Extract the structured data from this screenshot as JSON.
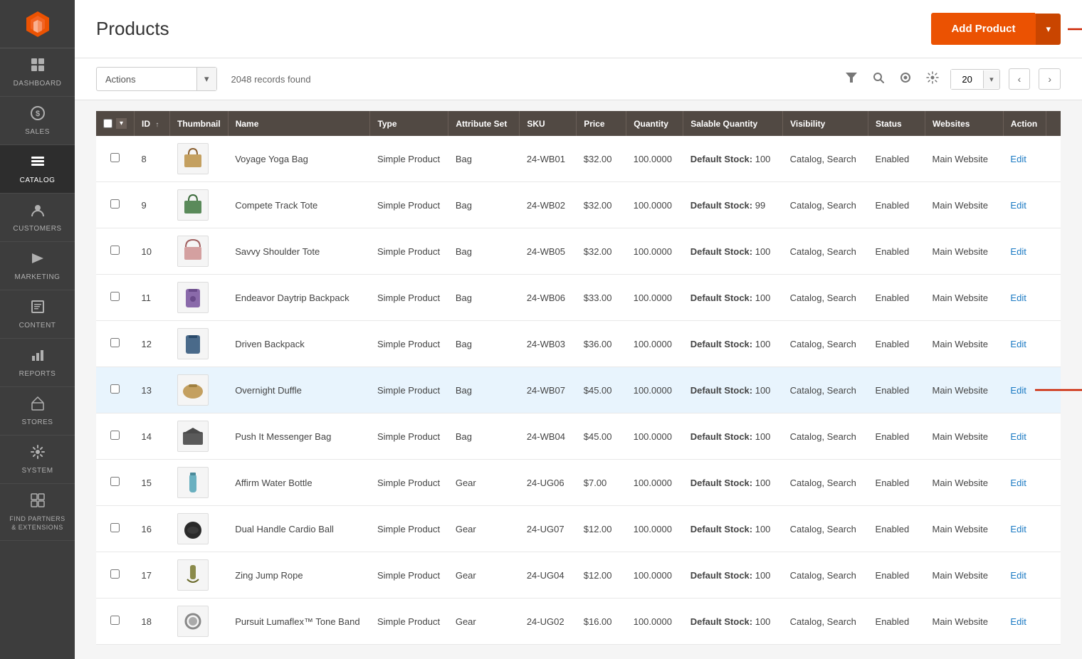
{
  "sidebar": {
    "logo_color": "#eb5202",
    "items": [
      {
        "id": "dashboard",
        "label": "DASHBOARD",
        "icon": "⊞",
        "active": false
      },
      {
        "id": "sales",
        "label": "SALES",
        "icon": "$",
        "active": false
      },
      {
        "id": "catalog",
        "label": "CATALOG",
        "icon": "☷",
        "active": true
      },
      {
        "id": "customers",
        "label": "CUSTOMERS",
        "icon": "👤",
        "active": false
      },
      {
        "id": "marketing",
        "label": "MARKETING",
        "icon": "📢",
        "active": false
      },
      {
        "id": "content",
        "label": "CONTENT",
        "icon": "▦",
        "active": false
      },
      {
        "id": "reports",
        "label": "REPORTS",
        "icon": "📊",
        "active": false
      },
      {
        "id": "stores",
        "label": "STORES",
        "icon": "🏪",
        "active": false
      },
      {
        "id": "system",
        "label": "SYSTEM",
        "icon": "⚙",
        "active": false
      },
      {
        "id": "find-partners",
        "label": "FIND PARTNERS & EXTENSIONS",
        "icon": "🧩",
        "active": false
      }
    ]
  },
  "header": {
    "title": "Products",
    "add_button_label": "Add Product",
    "add_button_arrow": "▾"
  },
  "toolbar": {
    "actions_label": "Actions",
    "records_count": "2048 records found",
    "per_page_value": "20",
    "per_page_placeholder": "20",
    "prev_label": "‹",
    "next_label": "›"
  },
  "table": {
    "columns": [
      {
        "id": "cb",
        "label": ""
      },
      {
        "id": "id",
        "label": "ID",
        "sortable": true
      },
      {
        "id": "thumbnail",
        "label": "Thumbnail"
      },
      {
        "id": "name",
        "label": "Name"
      },
      {
        "id": "type",
        "label": "Type"
      },
      {
        "id": "attribute_set",
        "label": "Attribute Set"
      },
      {
        "id": "sku",
        "label": "SKU"
      },
      {
        "id": "price",
        "label": "Price"
      },
      {
        "id": "quantity",
        "label": "Quantity"
      },
      {
        "id": "salable_quantity",
        "label": "Salable Quantity"
      },
      {
        "id": "visibility",
        "label": "Visibility"
      },
      {
        "id": "status",
        "label": "Status"
      },
      {
        "id": "websites",
        "label": "Websites"
      },
      {
        "id": "action",
        "label": "Action"
      },
      {
        "id": "more",
        "label": ""
      }
    ],
    "rows": [
      {
        "id": 8,
        "name": "Voyage Yoga Bag",
        "type": "Simple Product",
        "attribute_set": "Bag",
        "sku": "24-WB01",
        "price": "$32.00",
        "quantity": "100.0000",
        "salable_quantity": "Default Stock: 100",
        "visibility": "Catalog, Search",
        "status": "Enabled",
        "websites": "Main Website",
        "highlighted": false
      },
      {
        "id": 9,
        "name": "Compete Track Tote",
        "type": "Simple Product",
        "attribute_set": "Bag",
        "sku": "24-WB02",
        "price": "$32.00",
        "quantity": "100.0000",
        "salable_quantity": "Default Stock: 99",
        "visibility": "Catalog, Search",
        "status": "Enabled",
        "websites": "Main Website",
        "highlighted": false
      },
      {
        "id": 10,
        "name": "Savvy Shoulder Tote",
        "type": "Simple Product",
        "attribute_set": "Bag",
        "sku": "24-WB05",
        "price": "$32.00",
        "quantity": "100.0000",
        "salable_quantity": "Default Stock: 100",
        "visibility": "Catalog, Search",
        "status": "Enabled",
        "websites": "Main Website",
        "highlighted": false
      },
      {
        "id": 11,
        "name": "Endeavor Daytrip Backpack",
        "type": "Simple Product",
        "attribute_set": "Bag",
        "sku": "24-WB06",
        "price": "$33.00",
        "quantity": "100.0000",
        "salable_quantity": "Default Stock: 100",
        "visibility": "Catalog, Search",
        "status": "Enabled",
        "websites": "Main Website",
        "highlighted": false
      },
      {
        "id": 12,
        "name": "Driven Backpack",
        "type": "Simple Product",
        "attribute_set": "Bag",
        "sku": "24-WB03",
        "price": "$36.00",
        "quantity": "100.0000",
        "salable_quantity": "Default Stock: 100",
        "visibility": "Catalog, Search",
        "status": "Enabled",
        "websites": "Main Website",
        "highlighted": false
      },
      {
        "id": 13,
        "name": "Overnight Duffle",
        "type": "Simple Product",
        "attribute_set": "Bag",
        "sku": "24-WB07",
        "price": "$45.00",
        "quantity": "100.0000",
        "salable_quantity": "Default Stock: 100",
        "visibility": "Catalog, Search",
        "status": "Enabled",
        "websites": "Main Website",
        "highlighted": true
      },
      {
        "id": 14,
        "name": "Push It Messenger Bag",
        "type": "Simple Product",
        "attribute_set": "Bag",
        "sku": "24-WB04",
        "price": "$45.00",
        "quantity": "100.0000",
        "salable_quantity": "Default Stock: 100",
        "visibility": "Catalog, Search",
        "status": "Enabled",
        "websites": "Main Website",
        "highlighted": false
      },
      {
        "id": 15,
        "name": "Affirm Water Bottle",
        "type": "Simple Product",
        "attribute_set": "Gear",
        "sku": "24-UG06",
        "price": "$7.00",
        "quantity": "100.0000",
        "salable_quantity": "Default Stock: 100",
        "visibility": "Catalog, Search",
        "status": "Enabled",
        "websites": "Main Website",
        "highlighted": false
      },
      {
        "id": 16,
        "name": "Dual Handle Cardio Ball",
        "type": "Simple Product",
        "attribute_set": "Gear",
        "sku": "24-UG07",
        "price": "$12.00",
        "quantity": "100.0000",
        "salable_quantity": "Default Stock: 100",
        "visibility": "Catalog, Search",
        "status": "Enabled",
        "websites": "Main Website",
        "highlighted": false
      },
      {
        "id": 17,
        "name": "Zing Jump Rope",
        "type": "Simple Product",
        "attribute_set": "Gear",
        "sku": "24-UG04",
        "price": "$12.00",
        "quantity": "100.0000",
        "salable_quantity": "Default Stock: 100",
        "visibility": "Catalog, Search",
        "status": "Enabled",
        "websites": "Main Website",
        "highlighted": false
      },
      {
        "id": 18,
        "name": "Pursuit Lumaflex™ Tone Band",
        "type": "Simple Product",
        "attribute_set": "Gear",
        "sku": "24-UG02",
        "price": "$16.00",
        "quantity": "100.0000",
        "salable_quantity": "Default Stock: 100",
        "visibility": "Catalog, Search",
        "status": "Enabled",
        "websites": "Main Website",
        "highlighted": false
      }
    ]
  },
  "icons": {
    "filter": "▼",
    "search": "🔍",
    "eye": "👁",
    "settings": "⚙",
    "sort_asc": "↑"
  }
}
